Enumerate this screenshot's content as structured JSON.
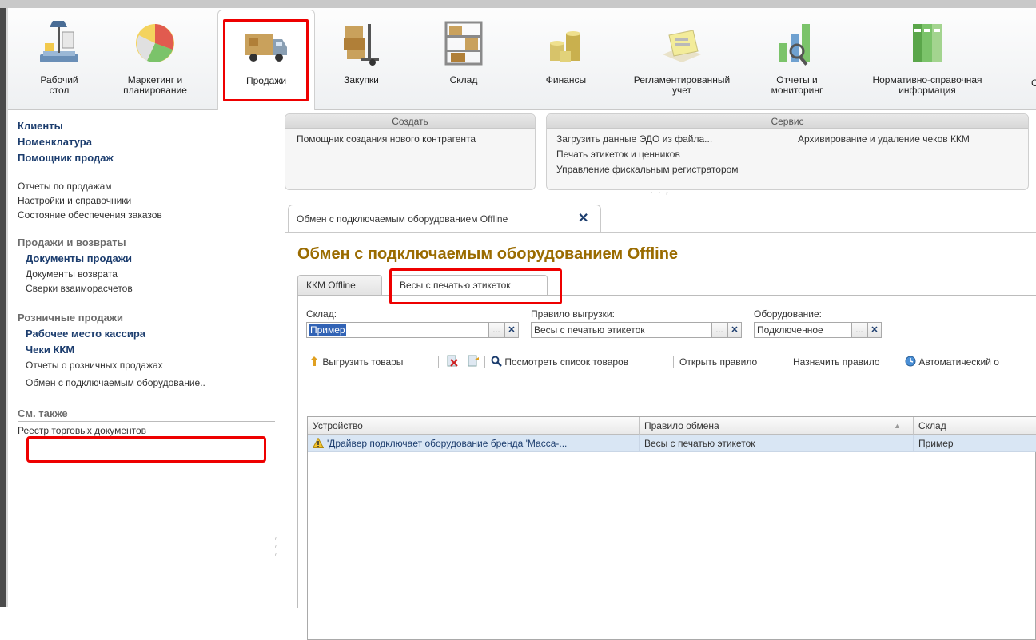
{
  "sections": [
    {
      "label": "Рабочий стол",
      "icon": "desk-lamp-icon"
    },
    {
      "label": "Маркетинг и планирование",
      "icon": "pie-chart-icon"
    },
    {
      "label": "Продажи",
      "icon": "delivery-truck-icon"
    },
    {
      "label": "Закупки",
      "icon": "hand-truck-boxes-icon"
    },
    {
      "label": "Склад",
      "icon": "warehouse-shelf-icon"
    },
    {
      "label": "Финансы",
      "icon": "coins-stack-icon"
    },
    {
      "label": "Регламентированный учет",
      "icon": "documents-folder-icon"
    },
    {
      "label": "Отчеты и мониторинг",
      "icon": "bar-chart-magnifier-icon"
    },
    {
      "label": "Нормативно-справочная информация",
      "icon": "binders-icon"
    },
    {
      "label": "С"
    }
  ],
  "active_section": "Продажи",
  "nav": {
    "top": [
      "Клиенты",
      "Номенклатура",
      "Помощник продаж"
    ],
    "reports": [
      "Отчеты по продажам",
      "Настройки и справочники",
      "Состояние обеспечения заказов"
    ],
    "group1": {
      "title": "Продажи и возвраты",
      "items": [
        "Документы продажи",
        "Документы возврата",
        "Сверки взаиморасчетов"
      ]
    },
    "group2": {
      "title": "Розничные продажи",
      "items": [
        "Рабочее место кассира",
        "Чеки ККМ",
        "Отчеты о розничных продажах",
        "Обмен с подключаемым оборудование.."
      ]
    },
    "see_also": {
      "title": "См. также",
      "items": [
        "Реестр торговых документов"
      ]
    }
  },
  "panels": {
    "create": {
      "title": "Создать",
      "items": [
        "Помощник создания нового контрагента"
      ]
    },
    "service": {
      "title": "Сервис",
      "col1": [
        "Загрузить данные ЭДО из файла...",
        "Печать этикеток и ценников",
        "Управление фискальным регистратором"
      ],
      "col2": [
        "Архивирование и удаление чеков ККМ"
      ]
    }
  },
  "doc_tab": {
    "label": "Обмен с подключаемым оборудованием Offline",
    "close": "✕"
  },
  "form": {
    "title": "Обмен с подключаемым оборудованием Offline",
    "tabs": [
      "ККМ Offline",
      "Весы с печатью этикеток"
    ],
    "active_tab": "Весы с печатью этикеток",
    "filters": {
      "sklad_label": "Склад:",
      "sklad_value": "Пример",
      "rule_label": "Правило выгрузки:",
      "rule_value": "Весы с печатью этикеток",
      "equip_label": "Оборудование:",
      "equip_value": "Подключенное"
    },
    "buttons": {
      "dots": "...",
      "clear": "✕"
    },
    "commands": [
      "Выгрузить товары",
      "Посмотреть список товаров",
      "Открыть правило",
      "Назначить правило",
      "Автоматический о"
    ],
    "grid": {
      "columns": [
        "Устройство",
        "Правило обмена",
        "Склад"
      ],
      "rows": [
        [
          "'Драйвер подключает оборудование бренда 'Масса-...",
          "Весы с печатью этикеток",
          "Пример"
        ]
      ]
    }
  },
  "colors": {
    "highlight": "#ee0000",
    "title": "#9a6b00",
    "link_bold": "#1c3d6e",
    "selection": "#d9e6f4"
  }
}
